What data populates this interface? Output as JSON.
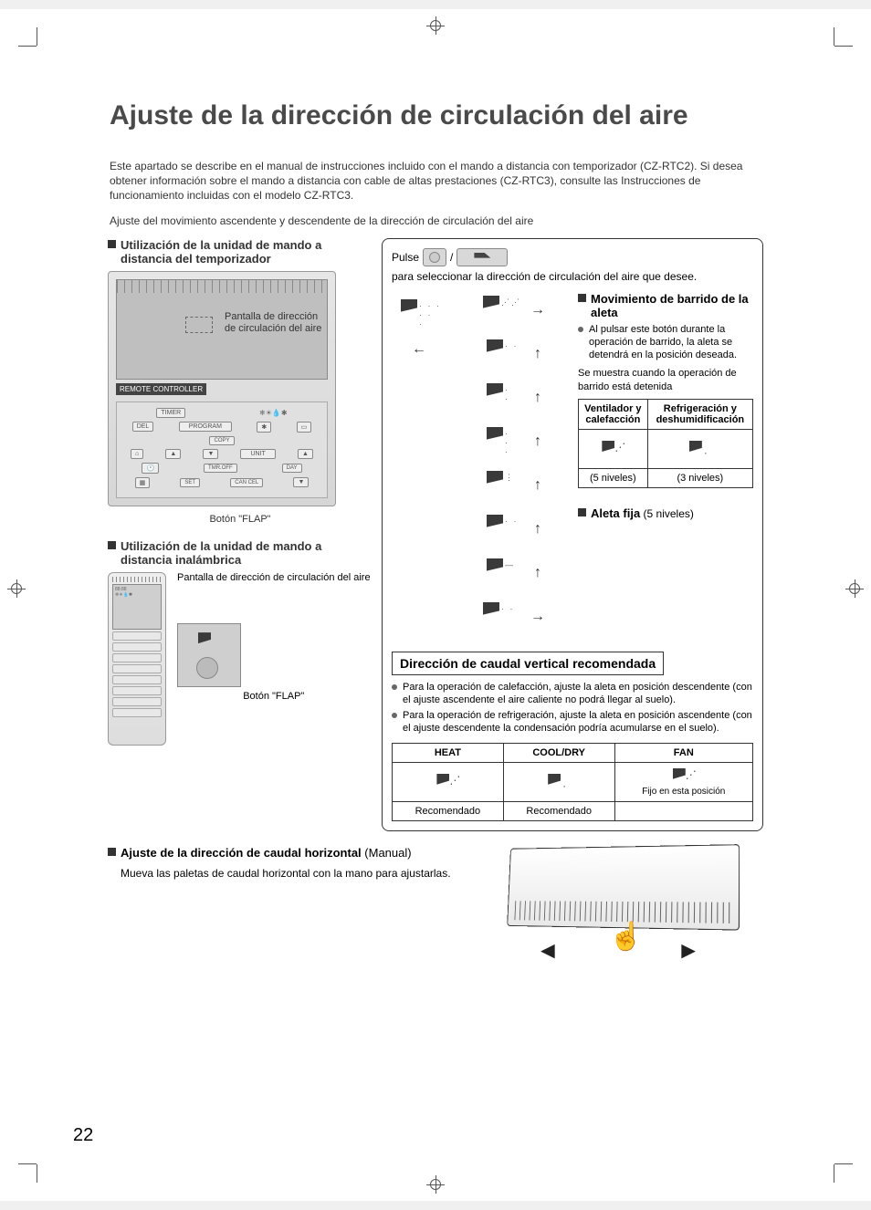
{
  "title": "Ajuste de la dirección de circulación del aire",
  "intro": "Este apartado se describe en el manual de instrucciones incluido con el mando a distancia con temporizador (CZ-RTC2). Si desea obtener información sobre el mando a distancia con cable de altas prestaciones (CZ-RTC3), consulte las Instrucciones de funcionamiento incluidas con el modelo CZ-RTC3.",
  "subhead": "Ajuste del movimiento ascendente y descendente de la dirección de circulación del aire",
  "left": {
    "timer_head": "Utilización de la unidad de mando a distancia del temporizador",
    "lcd_callout": "Pantalla de dirección de circulación del aire",
    "rc_label": "REMOTE CONTROLLER",
    "btn_timer": "TIMER",
    "btn_program": "PROGRAM",
    "btn_copy": "COPY",
    "btn_del": "DEL",
    "btn_unit": "UNIT",
    "btn_set": "SET",
    "btn_cancel": "CAN CEL",
    "btn_tmroff": "TMR.OFF",
    "btn_day": "DAY",
    "flap_caption": "Botón \"FLAP\"",
    "wireless_head": "Utilización de la unidad de mando a distancia inalámbrica",
    "wireless_callout": "Pantalla de dirección de circulación del aire",
    "wireless_flap_caption": "Botón \"FLAP\""
  },
  "right": {
    "pulse_prefix": "Pulse",
    "pulse_mid": "/",
    "pulse_suffix": "para seleccionar la dirección de circulación del aire que desee.",
    "sweep_head": "Movimiento de barrido de la aleta",
    "sweep_bullet": "Al pulsar este botón durante la operación de barrido, la aleta se detendrá en la posición deseada.",
    "sweep_note": "Se muestra cuando la operación de barrido está detenida",
    "table_col1": "Ventilador y calefacción",
    "table_col2": "Refrigeración y deshumidificación",
    "levels5": "(5 niveles)",
    "levels3": "(3 niveles)",
    "fixed_head": "Aleta fija",
    "fixed_levels": "(5 niveles)",
    "rec_heading": "Dirección de caudal vertical recomendada",
    "rec_b1": "Para la operación de calefacción, ajuste la aleta en posición descendente (con el ajuste ascendente el aire caliente no podrá llegar al suelo).",
    "rec_b2": "Para la operación de refrigeración, ajuste la aleta en posición ascendente (con el ajuste descendente la condensación podría acumularse en el suelo).",
    "rec_th1": "HEAT",
    "rec_th2": "COOL/DRY",
    "rec_th3": "FAN",
    "rec_td1": "Recomendado",
    "rec_td2": "Recomendado",
    "rec_td3": "Fijo en esta posición"
  },
  "bottom": {
    "hz_head": "Ajuste de la dirección de caudal horizontal",
    "hz_paren": " (Manual)",
    "hz_body": "Mueva las paletas de caudal horizontal con la mano para ajustarlas."
  },
  "page_number": "22"
}
